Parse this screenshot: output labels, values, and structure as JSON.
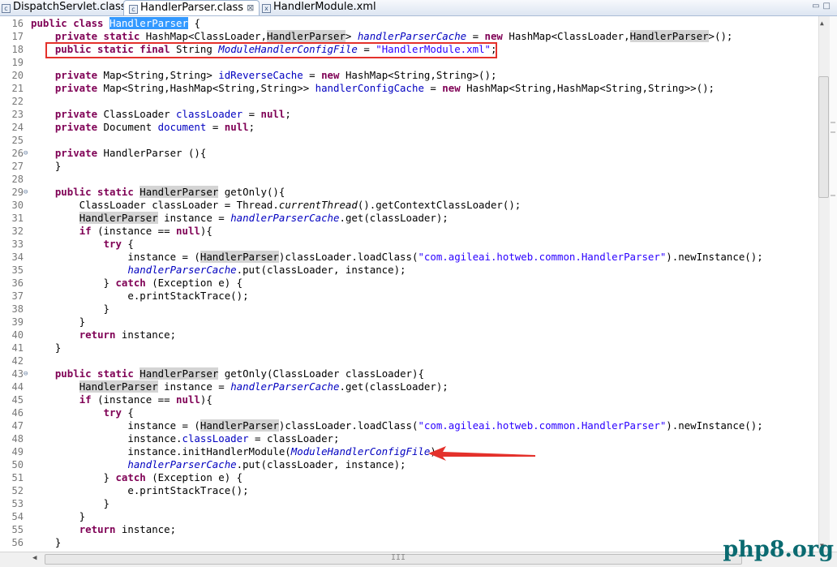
{
  "tabs": [
    {
      "label": "DispatchServlet.class",
      "active": false,
      "icon": "class-file-icon"
    },
    {
      "label": "HandlerParser.class",
      "active": true,
      "icon": "class-file-icon",
      "close": "⊠"
    },
    {
      "label": "HandlerModule.xml",
      "active": false,
      "icon": "xml-file-icon"
    }
  ],
  "window_controls": {
    "minimize": "▭",
    "maximize": "□"
  },
  "code_lines": [
    {
      "n": "16",
      "fold": "",
      "html": "<span class='kw'>public class</span> <span class='sel'>HandlerParser</span> {"
    },
    {
      "n": "17",
      "fold": "",
      "html": "    <span class='kw'>private static</span> HashMap&lt;ClassLoader,<span class='hl'>HandlerParser</span>&gt; <span class='fs'>handlerParserCache</span> = <span class='kw'>new</span> HashMap&lt;ClassLoader,<span class='hl'>HandlerParser</span>&gt;();"
    },
    {
      "n": "18",
      "fold": "",
      "html": "    <span class='kw'>public static final</span> String <span class='fs'>ModuleHandlerConfigFile</span> = <span class='st'>\"HandlerModule.xml\"</span>;"
    },
    {
      "n": "19",
      "fold": "",
      "html": ""
    },
    {
      "n": "20",
      "fold": "",
      "html": "    <span class='kw'>private</span> Map&lt;String,String&gt; <span class='fi'>idReverseCache</span> = <span class='kw'>new</span> HashMap&lt;String,String&gt;();"
    },
    {
      "n": "21",
      "fold": "",
      "html": "    <span class='kw'>private</span> Map&lt;String,HashMap&lt;String,String&gt;&gt; <span class='fi'>handlerConfigCache</span> = <span class='kw'>new</span> HashMap&lt;String,HashMap&lt;String,String&gt;&gt;();"
    },
    {
      "n": "22",
      "fold": "",
      "html": ""
    },
    {
      "n": "23",
      "fold": "",
      "html": "    <span class='kw'>private</span> ClassLoader <span class='fi'>classLoader</span> = <span class='kw'>null</span>;"
    },
    {
      "n": "24",
      "fold": "",
      "html": "    <span class='kw'>private</span> Document <span class='fi'>document</span> = <span class='kw'>null</span>;"
    },
    {
      "n": "25",
      "fold": "",
      "html": ""
    },
    {
      "n": "26",
      "fold": "⊖",
      "html": "    <span class='kw'>private</span> HandlerParser (){"
    },
    {
      "n": "27",
      "fold": "",
      "html": "    }"
    },
    {
      "n": "28",
      "fold": "",
      "html": ""
    },
    {
      "n": "29",
      "fold": "⊖",
      "html": "    <span class='kw'>public static</span> <span class='hl'>HandlerParser</span> getOnly(){"
    },
    {
      "n": "30",
      "fold": "",
      "html": "        ClassLoader classLoader = Thread.<span class='ms'>currentThread</span>().getContextClassLoader();"
    },
    {
      "n": "31",
      "fold": "",
      "html": "        <span class='hl'>HandlerParser</span> instance = <span class='fs'>handlerParserCache</span>.get(classLoader);"
    },
    {
      "n": "32",
      "fold": "",
      "html": "        <span class='kw'>if</span> (instance == <span class='kw'>null</span>){"
    },
    {
      "n": "33",
      "fold": "",
      "html": "            <span class='kw'>try</span> {"
    },
    {
      "n": "34",
      "fold": "",
      "html": "                instance = (<span class='hl'>HandlerParser</span>)classLoader.loadClass(<span class='st'>\"com.agileai.hotweb.common.HandlerParser\"</span>).newInstance();"
    },
    {
      "n": "35",
      "fold": "",
      "html": "                <span class='fs'>handlerParserCache</span>.put(classLoader, instance);"
    },
    {
      "n": "36",
      "fold": "",
      "html": "            } <span class='kw'>catch</span> (Exception e) {"
    },
    {
      "n": "37",
      "fold": "",
      "html": "                e.printStackTrace();"
    },
    {
      "n": "38",
      "fold": "",
      "html": "            }"
    },
    {
      "n": "39",
      "fold": "",
      "html": "        }"
    },
    {
      "n": "40",
      "fold": "",
      "html": "        <span class='kw'>return</span> instance;"
    },
    {
      "n": "41",
      "fold": "",
      "html": "    }"
    },
    {
      "n": "42",
      "fold": "",
      "html": ""
    },
    {
      "n": "43",
      "fold": "⊖",
      "html": "    <span class='kw'>public static</span> <span class='hl'>HandlerParser</span> getOnly(ClassLoader classLoader){"
    },
    {
      "n": "44",
      "fold": "",
      "html": "        <span class='hl'>HandlerParser</span> instance = <span class='fs'>handlerParserCache</span>.get(classLoader);"
    },
    {
      "n": "45",
      "fold": "",
      "html": "        <span class='kw'>if</span> (instance == <span class='kw'>null</span>){"
    },
    {
      "n": "46",
      "fold": "",
      "html": "            <span class='kw'>try</span> {"
    },
    {
      "n": "47",
      "fold": "",
      "html": "                instance = (<span class='hl'>HandlerParser</span>)classLoader.loadClass(<span class='st'>\"com.agileai.hotweb.common.HandlerParser\"</span>).newInstance();"
    },
    {
      "n": "48",
      "fold": "",
      "html": "                instance.<span class='fi'>classLoader</span> = classLoader;"
    },
    {
      "n": "49",
      "fold": "",
      "html": "                instance.initHandlerModule(<span class='fs'>ModuleHandlerConfigFile</span>);"
    },
    {
      "n": "50",
      "fold": "",
      "html": "                <span class='fs'>handlerParserCache</span>.put(classLoader, instance);"
    },
    {
      "n": "51",
      "fold": "",
      "html": "            } <span class='kw'>catch</span> (Exception e) {"
    },
    {
      "n": "52",
      "fold": "",
      "html": "                e.printStackTrace();"
    },
    {
      "n": "53",
      "fold": "",
      "html": "            }"
    },
    {
      "n": "54",
      "fold": "",
      "html": "        }"
    },
    {
      "n": "55",
      "fold": "",
      "html": "        <span class='kw'>return</span> instance;"
    },
    {
      "n": "56",
      "fold": "",
      "html": "    }"
    }
  ],
  "annotations": {
    "highlight_line": "18",
    "arrow_line": "49",
    "color": "#e4312b"
  },
  "scrollbar": {
    "h_grip": "III"
  },
  "watermark": "php8.org",
  "colors": {
    "keyword": "#7f0055",
    "field": "#0000c0",
    "string": "#2a00ff",
    "selection": "#3399ff",
    "occurrence": "#d4d4d4"
  }
}
